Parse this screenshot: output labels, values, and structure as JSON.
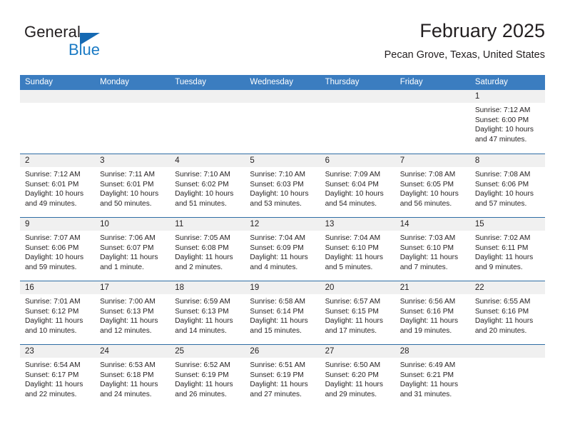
{
  "brand": {
    "name_top": "General",
    "name_bottom": "Blue",
    "triangle_color": "#1669b2",
    "blue_color": "#1a7ac4"
  },
  "header": {
    "title": "February 2025",
    "subtitle": "Pecan Grove, Texas, United States"
  },
  "theme": {
    "header_row_bg": "#3b7dc0",
    "row_divider": "#2e6da4",
    "day_band_bg": "#f0f0f0",
    "text": "#231f20"
  },
  "weekdays": [
    "Sunday",
    "Monday",
    "Tuesday",
    "Wednesday",
    "Thursday",
    "Friday",
    "Saturday"
  ],
  "weeks": [
    [
      {
        "day": "",
        "sunrise": "",
        "sunset": "",
        "daylight_line1": "",
        "daylight_line2": "",
        "empty": true
      },
      {
        "day": "",
        "sunrise": "",
        "sunset": "",
        "daylight_line1": "",
        "daylight_line2": "",
        "empty": true
      },
      {
        "day": "",
        "sunrise": "",
        "sunset": "",
        "daylight_line1": "",
        "daylight_line2": "",
        "empty": true
      },
      {
        "day": "",
        "sunrise": "",
        "sunset": "",
        "daylight_line1": "",
        "daylight_line2": "",
        "empty": true
      },
      {
        "day": "",
        "sunrise": "",
        "sunset": "",
        "daylight_line1": "",
        "daylight_line2": "",
        "empty": true
      },
      {
        "day": "",
        "sunrise": "",
        "sunset": "",
        "daylight_line1": "",
        "daylight_line2": "",
        "empty": true
      },
      {
        "day": "1",
        "sunrise": "Sunrise: 7:12 AM",
        "sunset": "Sunset: 6:00 PM",
        "daylight_line1": "Daylight: 10 hours",
        "daylight_line2": "and 47 minutes.",
        "empty": false
      }
    ],
    [
      {
        "day": "2",
        "sunrise": "Sunrise: 7:12 AM",
        "sunset": "Sunset: 6:01 PM",
        "daylight_line1": "Daylight: 10 hours",
        "daylight_line2": "and 49 minutes.",
        "empty": false
      },
      {
        "day": "3",
        "sunrise": "Sunrise: 7:11 AM",
        "sunset": "Sunset: 6:01 PM",
        "daylight_line1": "Daylight: 10 hours",
        "daylight_line2": "and 50 minutes.",
        "empty": false
      },
      {
        "day": "4",
        "sunrise": "Sunrise: 7:10 AM",
        "sunset": "Sunset: 6:02 PM",
        "daylight_line1": "Daylight: 10 hours",
        "daylight_line2": "and 51 minutes.",
        "empty": false
      },
      {
        "day": "5",
        "sunrise": "Sunrise: 7:10 AM",
        "sunset": "Sunset: 6:03 PM",
        "daylight_line1": "Daylight: 10 hours",
        "daylight_line2": "and 53 minutes.",
        "empty": false
      },
      {
        "day": "6",
        "sunrise": "Sunrise: 7:09 AM",
        "sunset": "Sunset: 6:04 PM",
        "daylight_line1": "Daylight: 10 hours",
        "daylight_line2": "and 54 minutes.",
        "empty": false
      },
      {
        "day": "7",
        "sunrise": "Sunrise: 7:08 AM",
        "sunset": "Sunset: 6:05 PM",
        "daylight_line1": "Daylight: 10 hours",
        "daylight_line2": "and 56 minutes.",
        "empty": false
      },
      {
        "day": "8",
        "sunrise": "Sunrise: 7:08 AM",
        "sunset": "Sunset: 6:06 PM",
        "daylight_line1": "Daylight: 10 hours",
        "daylight_line2": "and 57 minutes.",
        "empty": false
      }
    ],
    [
      {
        "day": "9",
        "sunrise": "Sunrise: 7:07 AM",
        "sunset": "Sunset: 6:06 PM",
        "daylight_line1": "Daylight: 10 hours",
        "daylight_line2": "and 59 minutes.",
        "empty": false
      },
      {
        "day": "10",
        "sunrise": "Sunrise: 7:06 AM",
        "sunset": "Sunset: 6:07 PM",
        "daylight_line1": "Daylight: 11 hours",
        "daylight_line2": "and 1 minute.",
        "empty": false
      },
      {
        "day": "11",
        "sunrise": "Sunrise: 7:05 AM",
        "sunset": "Sunset: 6:08 PM",
        "daylight_line1": "Daylight: 11 hours",
        "daylight_line2": "and 2 minutes.",
        "empty": false
      },
      {
        "day": "12",
        "sunrise": "Sunrise: 7:04 AM",
        "sunset": "Sunset: 6:09 PM",
        "daylight_line1": "Daylight: 11 hours",
        "daylight_line2": "and 4 minutes.",
        "empty": false
      },
      {
        "day": "13",
        "sunrise": "Sunrise: 7:04 AM",
        "sunset": "Sunset: 6:10 PM",
        "daylight_line1": "Daylight: 11 hours",
        "daylight_line2": "and 5 minutes.",
        "empty": false
      },
      {
        "day": "14",
        "sunrise": "Sunrise: 7:03 AM",
        "sunset": "Sunset: 6:10 PM",
        "daylight_line1": "Daylight: 11 hours",
        "daylight_line2": "and 7 minutes.",
        "empty": false
      },
      {
        "day": "15",
        "sunrise": "Sunrise: 7:02 AM",
        "sunset": "Sunset: 6:11 PM",
        "daylight_line1": "Daylight: 11 hours",
        "daylight_line2": "and 9 minutes.",
        "empty": false
      }
    ],
    [
      {
        "day": "16",
        "sunrise": "Sunrise: 7:01 AM",
        "sunset": "Sunset: 6:12 PM",
        "daylight_line1": "Daylight: 11 hours",
        "daylight_line2": "and 10 minutes.",
        "empty": false
      },
      {
        "day": "17",
        "sunrise": "Sunrise: 7:00 AM",
        "sunset": "Sunset: 6:13 PM",
        "daylight_line1": "Daylight: 11 hours",
        "daylight_line2": "and 12 minutes.",
        "empty": false
      },
      {
        "day": "18",
        "sunrise": "Sunrise: 6:59 AM",
        "sunset": "Sunset: 6:13 PM",
        "daylight_line1": "Daylight: 11 hours",
        "daylight_line2": "and 14 minutes.",
        "empty": false
      },
      {
        "day": "19",
        "sunrise": "Sunrise: 6:58 AM",
        "sunset": "Sunset: 6:14 PM",
        "daylight_line1": "Daylight: 11 hours",
        "daylight_line2": "and 15 minutes.",
        "empty": false
      },
      {
        "day": "20",
        "sunrise": "Sunrise: 6:57 AM",
        "sunset": "Sunset: 6:15 PM",
        "daylight_line1": "Daylight: 11 hours",
        "daylight_line2": "and 17 minutes.",
        "empty": false
      },
      {
        "day": "21",
        "sunrise": "Sunrise: 6:56 AM",
        "sunset": "Sunset: 6:16 PM",
        "daylight_line1": "Daylight: 11 hours",
        "daylight_line2": "and 19 minutes.",
        "empty": false
      },
      {
        "day": "22",
        "sunrise": "Sunrise: 6:55 AM",
        "sunset": "Sunset: 6:16 PM",
        "daylight_line1": "Daylight: 11 hours",
        "daylight_line2": "and 20 minutes.",
        "empty": false
      }
    ],
    [
      {
        "day": "23",
        "sunrise": "Sunrise: 6:54 AM",
        "sunset": "Sunset: 6:17 PM",
        "daylight_line1": "Daylight: 11 hours",
        "daylight_line2": "and 22 minutes.",
        "empty": false
      },
      {
        "day": "24",
        "sunrise": "Sunrise: 6:53 AM",
        "sunset": "Sunset: 6:18 PM",
        "daylight_line1": "Daylight: 11 hours",
        "daylight_line2": "and 24 minutes.",
        "empty": false
      },
      {
        "day": "25",
        "sunrise": "Sunrise: 6:52 AM",
        "sunset": "Sunset: 6:19 PM",
        "daylight_line1": "Daylight: 11 hours",
        "daylight_line2": "and 26 minutes.",
        "empty": false
      },
      {
        "day": "26",
        "sunrise": "Sunrise: 6:51 AM",
        "sunset": "Sunset: 6:19 PM",
        "daylight_line1": "Daylight: 11 hours",
        "daylight_line2": "and 27 minutes.",
        "empty": false
      },
      {
        "day": "27",
        "sunrise": "Sunrise: 6:50 AM",
        "sunset": "Sunset: 6:20 PM",
        "daylight_line1": "Daylight: 11 hours",
        "daylight_line2": "and 29 minutes.",
        "empty": false
      },
      {
        "day": "28",
        "sunrise": "Sunrise: 6:49 AM",
        "sunset": "Sunset: 6:21 PM",
        "daylight_line1": "Daylight: 11 hours",
        "daylight_line2": "and 31 minutes.",
        "empty": false
      },
      {
        "day": "",
        "sunrise": "",
        "sunset": "",
        "daylight_line1": "",
        "daylight_line2": "",
        "empty": true
      }
    ]
  ]
}
